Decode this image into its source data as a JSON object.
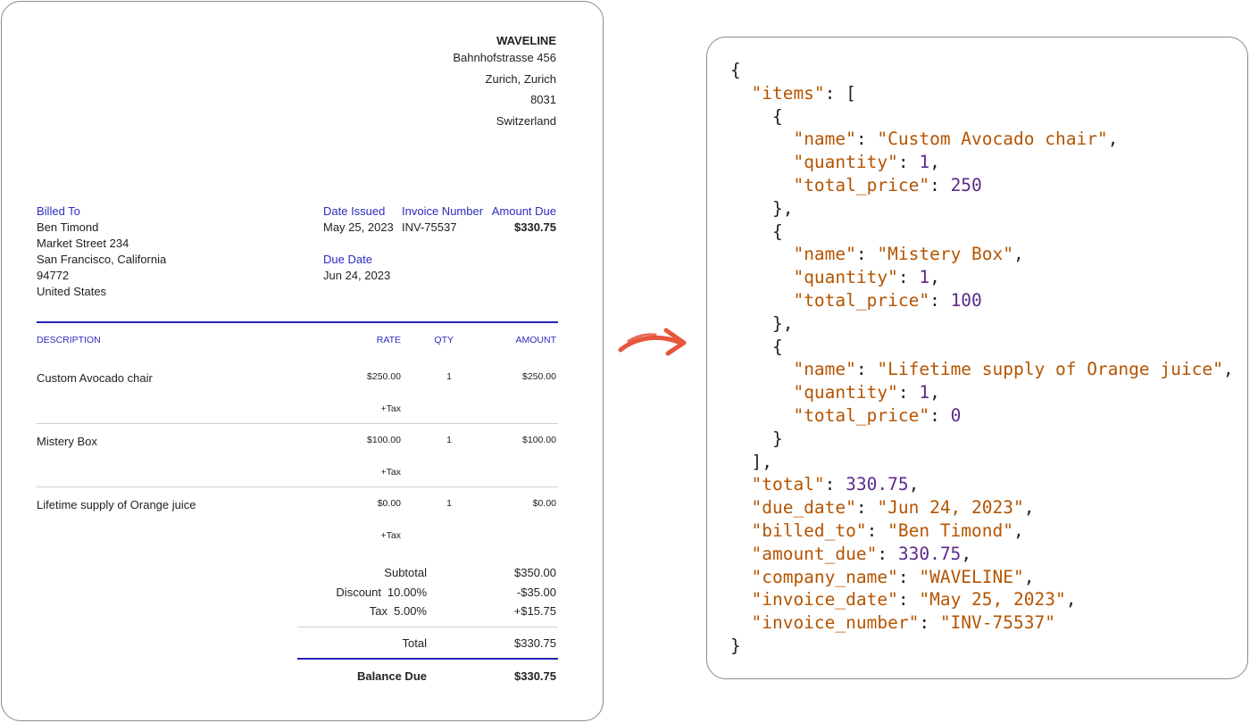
{
  "company": {
    "name": "WAVELINE",
    "address_lines": [
      "Bahnhofstrasse 456",
      "Zurich, Zurich",
      "8031",
      "Switzerland"
    ]
  },
  "billed_to": {
    "label": "Billed To",
    "lines": [
      "Ben Timond",
      "Market Street 234",
      "San Francisco, California",
      "94772",
      "United States"
    ]
  },
  "meta": {
    "date_issued_label": "Date Issued",
    "date_issued": "May 25, 2023",
    "invoice_number_label": "Invoice Number",
    "invoice_number": "INV-75537",
    "amount_due_label": "Amount Due",
    "amount_due": "$330.75",
    "due_date_label": "Due Date",
    "due_date": "Jun 24, 2023"
  },
  "table": {
    "headers": {
      "description": "DESCRIPTION",
      "rate": "RATE",
      "qty": "QTY",
      "amount": "AMOUNT"
    },
    "rows": [
      {
        "description": "Custom Avocado chair",
        "rate": "$250.00",
        "qty": "1",
        "amount": "$250.00",
        "tax": "+Tax"
      },
      {
        "description": "Mistery Box",
        "rate": "$100.00",
        "qty": "1",
        "amount": "$100.00",
        "tax": "+Tax"
      },
      {
        "description": "Lifetime supply of Orange juice",
        "rate": "$0.00",
        "qty": "1",
        "amount": "$0.00",
        "tax": "+Tax"
      }
    ]
  },
  "totals": {
    "subtotal_label": "Subtotal",
    "subtotal": "$350.00",
    "discount_label": "Discount",
    "discount_rate": "10.00%",
    "discount": "-$35.00",
    "tax_label": "Tax",
    "tax_rate": "5.00%",
    "tax": "+$15.75",
    "total_label": "Total",
    "total": "$330.75",
    "balance_label": "Balance Due",
    "balance": "$330.75"
  },
  "arrow_icon": "curved-arrow-icon",
  "colors": {
    "accent_blue": "#2c2cbf",
    "json_key": "#b55400",
    "json_number": "#5a2b8a"
  },
  "json_lines": [
    [
      [
        "p",
        "{"
      ]
    ],
    [
      [
        "p",
        "  "
      ],
      [
        "k",
        "\"items\""
      ],
      [
        "p",
        ": ["
      ]
    ],
    [
      [
        "p",
        "    {"
      ]
    ],
    [
      [
        "p",
        "      "
      ],
      [
        "k",
        "\"name\""
      ],
      [
        "p",
        ": "
      ],
      [
        "s",
        "\"Custom Avocado chair\""
      ],
      [
        "p",
        ","
      ]
    ],
    [
      [
        "p",
        "      "
      ],
      [
        "k",
        "\"quantity\""
      ],
      [
        "p",
        ": "
      ],
      [
        "n",
        "1"
      ],
      [
        "p",
        ","
      ]
    ],
    [
      [
        "p",
        "      "
      ],
      [
        "k",
        "\"total_price\""
      ],
      [
        "p",
        ": "
      ],
      [
        "n",
        "250"
      ]
    ],
    [
      [
        "p",
        "    },"
      ]
    ],
    [
      [
        "p",
        "    {"
      ]
    ],
    [
      [
        "p",
        "      "
      ],
      [
        "k",
        "\"name\""
      ],
      [
        "p",
        ": "
      ],
      [
        "s",
        "\"Mistery Box\""
      ],
      [
        "p",
        ","
      ]
    ],
    [
      [
        "p",
        "      "
      ],
      [
        "k",
        "\"quantity\""
      ],
      [
        "p",
        ": "
      ],
      [
        "n",
        "1"
      ],
      [
        "p",
        ","
      ]
    ],
    [
      [
        "p",
        "      "
      ],
      [
        "k",
        "\"total_price\""
      ],
      [
        "p",
        ": "
      ],
      [
        "n",
        "100"
      ]
    ],
    [
      [
        "p",
        "    },"
      ]
    ],
    [
      [
        "p",
        "    {"
      ]
    ],
    [
      [
        "p",
        "      "
      ],
      [
        "k",
        "\"name\""
      ],
      [
        "p",
        ": "
      ],
      [
        "s",
        "\"Lifetime supply of Orange juice\""
      ],
      [
        "p",
        ","
      ]
    ],
    [
      [
        "p",
        "      "
      ],
      [
        "k",
        "\"quantity\""
      ],
      [
        "p",
        ": "
      ],
      [
        "n",
        "1"
      ],
      [
        "p",
        ","
      ]
    ],
    [
      [
        "p",
        "      "
      ],
      [
        "k",
        "\"total_price\""
      ],
      [
        "p",
        ": "
      ],
      [
        "n",
        "0"
      ]
    ],
    [
      [
        "p",
        "    }"
      ]
    ],
    [
      [
        "p",
        "  ],"
      ]
    ],
    [
      [
        "p",
        "  "
      ],
      [
        "k",
        "\"total\""
      ],
      [
        "p",
        ": "
      ],
      [
        "n",
        "330.75"
      ],
      [
        "p",
        ","
      ]
    ],
    [
      [
        "p",
        "  "
      ],
      [
        "k",
        "\"due_date\""
      ],
      [
        "p",
        ": "
      ],
      [
        "s",
        "\"Jun 24, 2023\""
      ],
      [
        "p",
        ","
      ]
    ],
    [
      [
        "p",
        "  "
      ],
      [
        "k",
        "\"billed_to\""
      ],
      [
        "p",
        ": "
      ],
      [
        "s",
        "\"Ben Timond\""
      ],
      [
        "p",
        ","
      ]
    ],
    [
      [
        "p",
        "  "
      ],
      [
        "k",
        "\"amount_due\""
      ],
      [
        "p",
        ": "
      ],
      [
        "n",
        "330.75"
      ],
      [
        "p",
        ","
      ]
    ],
    [
      [
        "p",
        "  "
      ],
      [
        "k",
        "\"company_name\""
      ],
      [
        "p",
        ": "
      ],
      [
        "s",
        "\"WAVELINE\""
      ],
      [
        "p",
        ","
      ]
    ],
    [
      [
        "p",
        "  "
      ],
      [
        "k",
        "\"invoice_date\""
      ],
      [
        "p",
        ": "
      ],
      [
        "s",
        "\"May 25, 2023\""
      ],
      [
        "p",
        ","
      ]
    ],
    [
      [
        "p",
        "  "
      ],
      [
        "k",
        "\"invoice_number\""
      ],
      [
        "p",
        ": "
      ],
      [
        "s",
        "\"INV-75537\""
      ]
    ],
    [
      [
        "p",
        "}"
      ]
    ]
  ]
}
